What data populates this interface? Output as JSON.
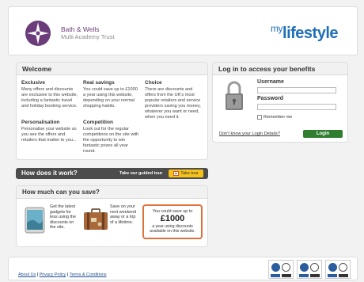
{
  "header": {
    "logo_line1": "Bath & Wells",
    "logo_line2": "Multi Academy Trust",
    "brand_prefix": "my",
    "brand_main": "lifestyle"
  },
  "welcome": {
    "title": "Welcome",
    "features": [
      {
        "heading": "Exclusive",
        "text": "Many offers and discounts are exclusive to this website, including a fantastic travel and holiday booking service."
      },
      {
        "heading": "Real savings",
        "text": "You could save up to £1000 a year using this website, depending on your normal shopping habits."
      },
      {
        "heading": "Choice",
        "text": "There are discounts and offers from the UK's most popular retailers and service providers saving you money, whatever you want or need, when you need it."
      },
      {
        "heading": "Personalisation",
        "text": "Personalise your website so you see the offers and retailers that matter to you..."
      },
      {
        "heading": "Competition",
        "text": "Look out for the regular competitions on the site with the opportunity to win fantastic prizes all year round."
      }
    ]
  },
  "login": {
    "title": "Log in to access your benefits",
    "username_label": "Username",
    "password_label": "Password",
    "remember_label": "Remember me",
    "forgot_link": "Don't know your Login Details?",
    "button_label": "Login"
  },
  "how": {
    "title": "How does it work?",
    "guided": "Take our guided tour",
    "tour_button": "Take tour"
  },
  "save": {
    "title": "How much can you save?",
    "item1": "Get the latest gadgets for less using the discounts on the site.",
    "item2": "Save on your next weekend away or a trip of a lifetime.",
    "box_line1": "You could save up to",
    "box_amount": "£1000",
    "box_line2": "a year using discounts available on this website."
  },
  "footer": {
    "about": "About Us",
    "privacy": "Privacy Policy",
    "terms": "Terms & Conditions",
    "separator": " | "
  },
  "colors": {
    "brand_blue": "#1f6fb8",
    "login_green": "#2f7d2f",
    "tour_yellow": "#f4c21a",
    "highlight_orange": "#e0703c"
  }
}
